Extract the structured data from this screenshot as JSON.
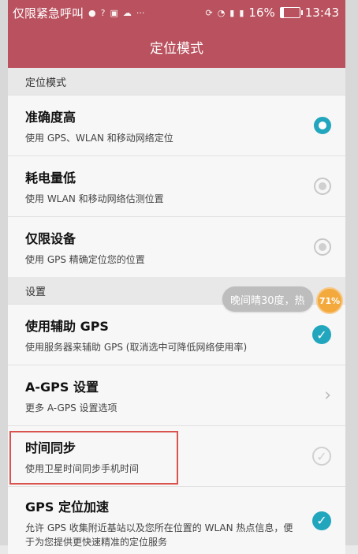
{
  "status_bar": {
    "left_text": "仅限紧急呼叫",
    "left_icons": [
      "app-notification-icon",
      "help-icon",
      "image-icon",
      "cloud-icon",
      "more-dots-icon"
    ],
    "right_icons": [
      "rotate-lock-icon",
      "wifi-icon",
      "sim-card-1-icon",
      "sim-card-2-icon",
      "battery-icon"
    ],
    "battery_percent": "16%",
    "time": "13:43",
    "colors": {
      "bar": "#b9515e"
    }
  },
  "header": {
    "title": "定位模式"
  },
  "sections": {
    "location_mode": {
      "label": "定位模式",
      "options": [
        {
          "title": "准确度高",
          "subtitle": "使用 GPS、WLAN 和移动网络定位",
          "selected": true
        },
        {
          "title": "耗电量低",
          "subtitle": "使用 WLAN 和移动网络估测位置",
          "selected": false
        },
        {
          "title": "仅限设备",
          "subtitle": "使用 GPS 精确定位您的位置",
          "selected": false
        }
      ]
    },
    "settings": {
      "label": "设置",
      "items": [
        {
          "title": "使用辅助 GPS",
          "subtitle": "使用服务器来辅助 GPS (取消选中可降低网络使用率)",
          "control": "checkbox",
          "checked": true
        },
        {
          "title": "A-GPS 设置",
          "subtitle": "更多 A-GPS 设置选项",
          "control": "chevron"
        },
        {
          "title": "时间同步",
          "subtitle": "使用卫星时间同步手机时间",
          "control": "checkbox",
          "checked": false
        },
        {
          "title": "GPS 定位加速",
          "subtitle": "允许 GPS 收集附近基站以及您所在位置的 WLAN 热点信息，便于为您提供更快速精准的定位服务",
          "control": "checkbox",
          "checked": true
        }
      ]
    }
  },
  "overlay": {
    "weather_text": "晚间晴30度，热",
    "orb_text": "71%",
    "accent_color": "#22a6bd",
    "highlight_color": "#d9534f"
  }
}
